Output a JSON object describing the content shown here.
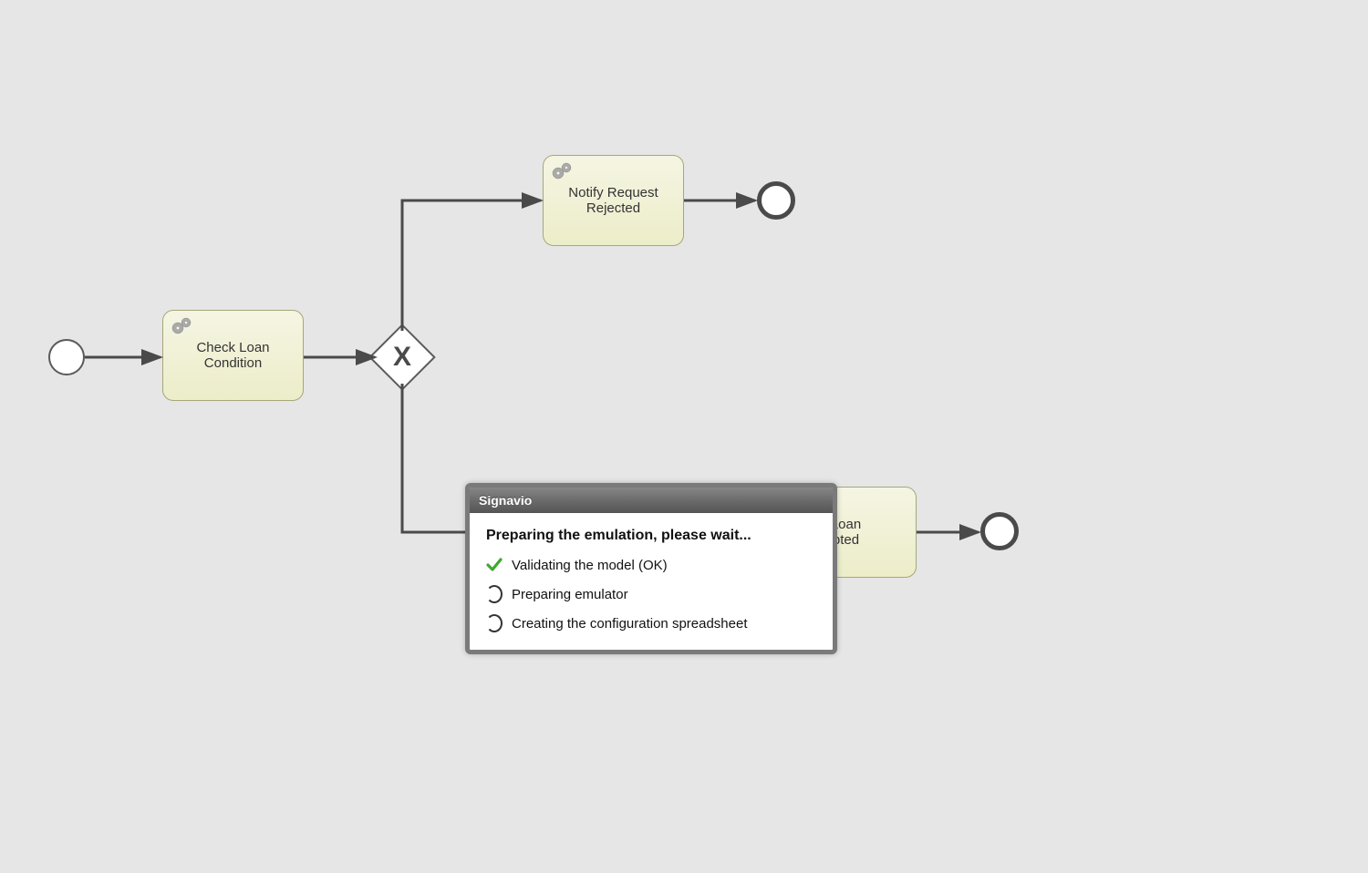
{
  "diagram": {
    "tasks": {
      "check_loan": "Check Loan Condition",
      "notify_rejected": "Notify Request Rejected",
      "notify_accepted_line1": "Loan",
      "notify_accepted_line2": "pted"
    },
    "gateway_symbol": "X"
  },
  "dialog": {
    "title": "Signavio",
    "heading": "Preparing the emulation, please wait...",
    "steps": [
      {
        "status": "done",
        "label": "Validating the model (OK)"
      },
      {
        "status": "pending",
        "label": "Preparing emulator"
      },
      {
        "status": "pending",
        "label": "Creating the configuration spreadsheet"
      }
    ]
  },
  "colors": {
    "task_fill_top": "#f5f5e3",
    "task_fill_bottom": "#ecedc9",
    "stroke": "#4a4a4a",
    "canvas_bg": "#e6e6e6"
  }
}
